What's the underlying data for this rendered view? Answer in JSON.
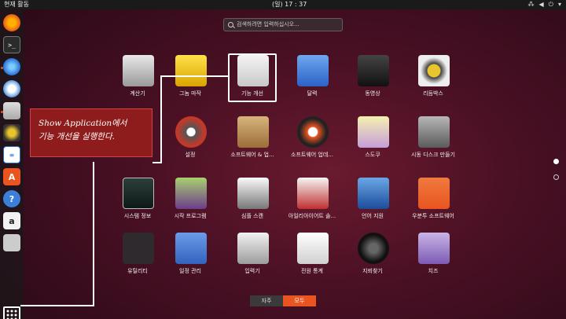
{
  "topbar": {
    "activities": "현재 활동",
    "clock": "(일) 17 : 37"
  },
  "search": {
    "placeholder": "검색하려면 입력하십시오..."
  },
  "apps": [
    {
      "label": "계산기",
      "icon": "calculator-icon"
    },
    {
      "label": "그놈 마작",
      "icon": "mahjongg-icon"
    },
    {
      "label": "기능 개선",
      "icon": "tweaks-icon"
    },
    {
      "label": "달력",
      "icon": "calendar-icon"
    },
    {
      "label": "동영상",
      "icon": "videos-icon"
    },
    {
      "label": "리듬박스",
      "icon": "rhythmbox-icon"
    },
    {
      "label": "설정",
      "icon": "settings-icon"
    },
    {
      "label": "소프트웨어 & 업...",
      "icon": "software-updates-icon"
    },
    {
      "label": "소프트웨어 업데...",
      "icon": "software-updater-icon"
    },
    {
      "label": "스도쿠",
      "icon": "sudoku-icon"
    },
    {
      "label": "시동 디스크 만들기",
      "icon": "startup-disk-icon"
    },
    {
      "label": "시스템 정보",
      "icon": "system-monitor-icon"
    },
    {
      "label": "시작 프로그램",
      "icon": "startup-apps-icon"
    },
    {
      "label": "심플 스캔",
      "icon": "scanner-icon"
    },
    {
      "label": "아일리아이어트 솔...",
      "icon": "solitaire-icon"
    },
    {
      "label": "언어 지원",
      "icon": "language-icon"
    },
    {
      "label": "우분투 소프트웨어",
      "icon": "ubuntu-software-icon"
    },
    {
      "label": "유틸리티",
      "icon": "utilities-folder-icon"
    },
    {
      "label": "일정 관리",
      "icon": "todo-icon"
    },
    {
      "label": "입력기",
      "icon": "keyboard-icon"
    },
    {
      "label": "전원 통계",
      "icon": "power-stats-icon"
    },
    {
      "label": "지뢰찾기",
      "icon": "mines-icon"
    },
    {
      "label": "치즈",
      "icon": "cheese-icon"
    }
  ],
  "switch": {
    "frequent": "자주",
    "all": "모두"
  },
  "annotation": {
    "line1": "Show Application에서",
    "line2": "기능 개선을 실행한다."
  },
  "colors": {
    "accent": "#e95420",
    "callout": "#8e1c1c"
  }
}
